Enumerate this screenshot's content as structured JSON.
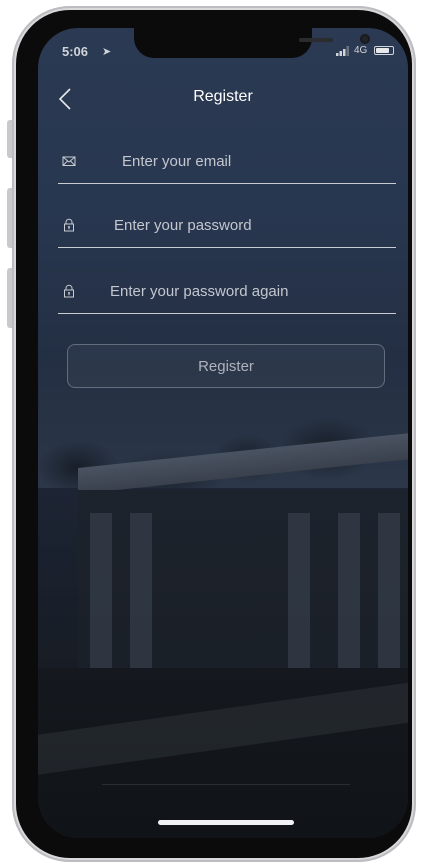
{
  "status_bar": {
    "time": "5:06",
    "location_icon": "location-arrow-icon",
    "network": "4G",
    "signal_icon": "signal-bars-icon",
    "battery_icon": "battery-icon"
  },
  "nav": {
    "back_icon": "chevron-left-icon",
    "title": "Register"
  },
  "form": {
    "email": {
      "icon": "envelope-icon",
      "value": "",
      "placeholder": "Enter your email"
    },
    "password": {
      "icon": "lock-icon",
      "value": "",
      "placeholder": "Enter your password"
    },
    "password_again": {
      "icon": "lock-icon",
      "value": "",
      "placeholder": "Enter your password again"
    },
    "submit_label": "Register"
  },
  "colors": {
    "text_primary": "#ffffff",
    "field_underline": "#c9ccd2",
    "button_text": "#aeb3bc"
  }
}
